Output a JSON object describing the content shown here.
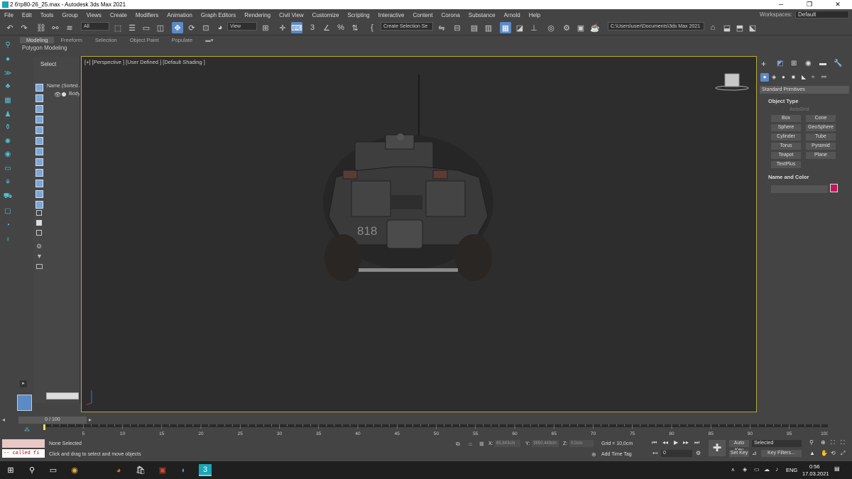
{
  "window": {
    "title": "2 бтр80-26_25.max - Autodesk 3ds Max 2021",
    "minimize": "─",
    "maximize": "❐",
    "close": "✕"
  },
  "menu": [
    "File",
    "Edit",
    "Tools",
    "Group",
    "Views",
    "Create",
    "Modifiers",
    "Animation",
    "Graph Editors",
    "Rendering",
    "Civil View",
    "Customize",
    "Scripting",
    "Interactive",
    "Content",
    "Corona",
    "Substance",
    "Arnold",
    "Help"
  ],
  "workspaces": {
    "label": "Workspaces:",
    "value": "Default"
  },
  "toolbar": {
    "selection_filter": "All",
    "ref_coord": "View",
    "named_sel": "Create Selection Se",
    "project_path": "C:\\Users\\user\\Documents\\3ds Max 2021"
  },
  "ribbon": {
    "tabs": [
      "Modeling",
      "Freeform",
      "Selection",
      "Object Paint",
      "Populate"
    ],
    "subtitle": "Polygon Modeling"
  },
  "scene_explorer": {
    "header": "Select",
    "column": "Name (Sorted A",
    "item": "Body"
  },
  "viewport": {
    "label": "[+] [Perspective ] [User Defined ] [Default Shading ]",
    "hull_number": "818"
  },
  "command_panel": {
    "dropdown": "Standard Primitives",
    "object_type": "Object Type",
    "autogrid": "AutoGrid",
    "buttons": [
      "Box",
      "Cone",
      "Sphere",
      "GeoSphere",
      "Cylinder",
      "Tube",
      "Torus",
      "Pyramid",
      "Teapot",
      "Plane",
      "TextPlus"
    ],
    "name_color": "Name and Color",
    "color": "#c2185b"
  },
  "timeline": {
    "slider": "0 / 100",
    "ticks": [
      "5",
      "10",
      "15",
      "20",
      "25",
      "30",
      "35",
      "40",
      "45",
      "50",
      "55",
      "60",
      "65",
      "70",
      "75",
      "80",
      "85",
      "90",
      "95",
      "100"
    ]
  },
  "status": {
    "maxscript": "-- called fi",
    "selection": "None Selected",
    "prompt": "Click and drag to select and move objects",
    "x_label": "X:",
    "x_val": "65,843cm",
    "y_label": "Y:",
    "y_val": "3650,449cm",
    "z_label": "Z:",
    "z_val": "0,0cm",
    "grid": "Grid = 10,0cm",
    "add_time_tag": "Add Time Tag",
    "frame": "0",
    "auto_key": "Auto Key",
    "set_key": "Set Key",
    "key_sel": "Selected",
    "key_filters": "Key Filters..."
  },
  "taskbar": {
    "lang": "ENG",
    "time": "0:56",
    "date": "17.03.2021"
  }
}
